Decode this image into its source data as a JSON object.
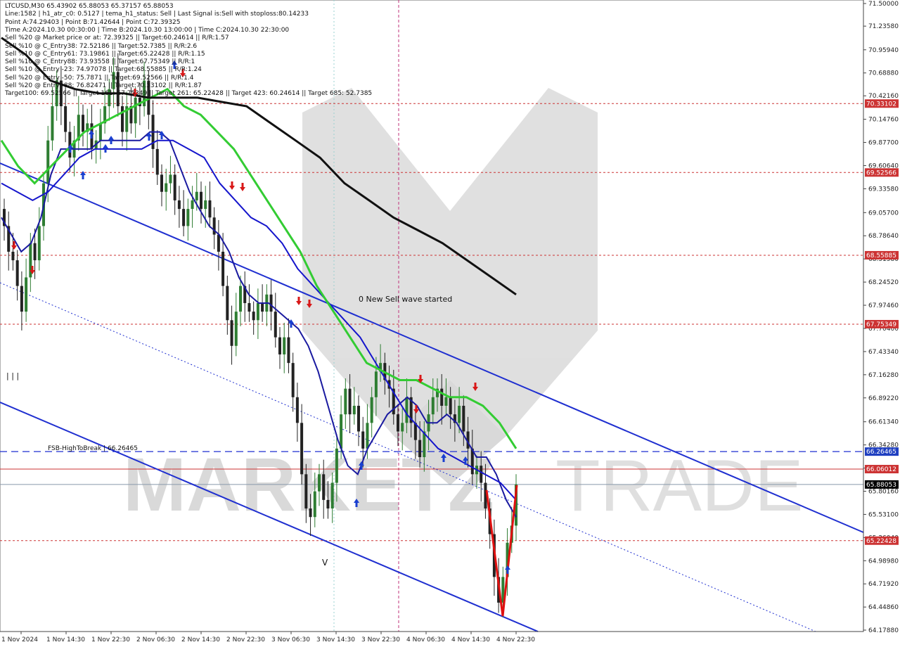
{
  "header": {
    "lines": [
      "LTCUSD,M30  65.43902 65.88053 65.37157 65.88053",
      "Line:1582  |  h1_atr_c0: 0.5127  |  tema_h1_status: Sell  |  Last Signal is:Sell with stoploss:80.14233",
      "Point A:74.29403  |  Point B:71.42644  |  Point C:72.39325",
      "Time A:2024.10.30 00:30:00  |  Time B:2024.10.30 13:00:00  |  Time C:2024.10.30 22:30:00",
      "Sell %20 @ Market price or at: 72.39325  ||  Target:60.24614  ||  R/R:1.57",
      "Sell %10 @ C_Entry38: 72.52186  ||  Target:52.7385  ||  R/R:2.6",
      "Sell %10 @ C_Entry61: 73.19861  ||  Target:65.22428  ||  R/R:1.15",
      "Sell %10 @ C_Entry88: 73.93558  ||  Target:67.75349  ||  R/R:1",
      "Sell %10 @ Entry -23: 74.97078  ||  Target:68.55885  ||  R/R:1.24",
      "Sell %20 @ Entry -50: 75.7871  ||  Target:69.52566  ||  R/R:1.4",
      "Sell %20 @ Entry -88: 76.82471  ||  Target:70.33102  ||  R/R:1.87",
      "Target100: 69.52566  ||  Target 161: 67.75349  ||  Target 261: 65.22428  ||  Target 423: 60.24614  ||  Target 685: 52.7385"
    ]
  },
  "annotations": {
    "sell_wave": "0 New Sell wave started",
    "fsb_label": "FSB-HighToBreak | 66.26465",
    "marks_left": "| | |",
    "v_mark": "V"
  },
  "watermark": {
    "text_left": "MARKETZ",
    "text_right": "TRADE"
  },
  "colors": {
    "bull_candle": "#2e7d32",
    "bear_candle": "#222222",
    "ema_fast": "#1a1aa0",
    "ema_mid": "#1515cc",
    "ema_green": "#33cc33",
    "ema_slow": "#111111",
    "channel": "#1f2fd0",
    "level_red": "#cc3333",
    "price_tag": "#000000",
    "fsb_tag": "#1f3fc0"
  },
  "chart_data": {
    "type": "candlestick",
    "symbol": "LTCUSD",
    "timeframe": "M30",
    "ohlc_last": {
      "open": 65.43902,
      "high": 65.88053,
      "low": 65.37157,
      "close": 65.88053
    },
    "ylim": [
      64.1788,
      71.5
    ],
    "y_ticks": [
      "71.50000",
      "71.23580",
      "70.95940",
      "70.68880",
      "70.42160",
      "70.14760",
      "69.87700",
      "69.60640",
      "69.33580",
      "69.05700",
      "68.78640",
      "68.51580",
      "68.24520",
      "67.97460",
      "67.70400",
      "67.43340",
      "67.16280",
      "66.89220",
      "66.61340",
      "66.34280",
      "66.07220",
      "65.80160",
      "65.53100",
      "65.26040",
      "64.98980",
      "64.71920",
      "64.44860",
      "64.17880"
    ],
    "x_ticks": [
      "1 Nov 2024",
      "1 Nov 14:30",
      "1 Nov 22:30",
      "2 Nov 06:30",
      "2 Nov 14:30",
      "2 Nov 22:30",
      "3 Nov 06:30",
      "3 Nov 14:30",
      "3 Nov 22:30",
      "4 Nov 06:30",
      "4 Nov 14:30",
      "4 Nov 22:30"
    ],
    "current_price": "65.88053",
    "levels": [
      {
        "value": 70.33102,
        "label": "70.33102",
        "kind": "target"
      },
      {
        "value": 69.52566,
        "label": "69.52566",
        "kind": "target"
      },
      {
        "value": 68.55885,
        "label": "68.55885",
        "kind": "target"
      },
      {
        "value": 67.75349,
        "label": "67.75349",
        "kind": "target"
      },
      {
        "value": 66.26465,
        "label": "66.26465",
        "kind": "fsb"
      },
      {
        "value": 66.06012,
        "label": "66.06012",
        "kind": "resistance"
      },
      {
        "value": 65.22428,
        "label": "65.22428",
        "kind": "target"
      }
    ],
    "closes": [
      68.9,
      68.6,
      68.5,
      68.2,
      67.9,
      68.3,
      68.7,
      68.5,
      68.9,
      69.4,
      69.9,
      70.3,
      70.6,
      70.3,
      70.0,
      69.7,
      69.9,
      70.2,
      70.0,
      70.1,
      69.8,
      69.9,
      70.1,
      70.3,
      70.5,
      70.7,
      70.3,
      70.0,
      70.3,
      70.1,
      70.4,
      70.3,
      70.6,
      70.2,
      69.8,
      69.5,
      69.3,
      69.4,
      69.5,
      69.2,
      69.1,
      68.9,
      69.1,
      69.2,
      69.3,
      69.1,
      69.2,
      69.0,
      68.8,
      68.6,
      68.2,
      67.8,
      67.5,
      67.9,
      68.2,
      68.0,
      67.9,
      67.8,
      68.0,
      67.9,
      68.1,
      67.9,
      67.6,
      67.4,
      67.6,
      67.3,
      66.9,
      66.6,
      66.0,
      65.6,
      65.5,
      65.8,
      66.0,
      65.7,
      65.6,
      65.9,
      66.3,
      66.7,
      67.0,
      66.7,
      66.8,
      66.5,
      66.3,
      66.6,
      66.9,
      67.2,
      67.3,
      67.1,
      67.0,
      66.7,
      66.5,
      66.6,
      66.9,
      66.6,
      66.4,
      66.2,
      66.5,
      66.7,
      66.9,
      67.0,
      66.8,
      66.9,
      66.7,
      66.6,
      66.8,
      66.5,
      66.3,
      66.0,
      66.1,
      65.9,
      65.6,
      65.3,
      64.8,
      64.5,
      64.8,
      65.2,
      65.4,
      65.88053
    ],
    "series": [
      {
        "name": "EMA fast",
        "color": "#1a1aa0",
        "values": [
          69.0,
          68.8,
          68.6,
          68.7,
          69.0,
          69.5,
          69.8,
          69.8,
          69.8,
          69.8,
          69.9,
          69.9,
          69.9,
          69.9,
          69.9,
          70.0,
          70.0,
          69.9,
          69.6,
          69.3,
          69.1,
          68.9,
          68.8,
          68.6,
          68.3,
          68.1,
          68.0,
          68.0,
          67.9,
          67.8,
          67.7,
          67.5,
          67.2,
          66.8,
          66.4,
          66.1,
          66.0,
          66.3,
          66.5,
          66.7,
          66.8,
          66.9,
          66.8,
          66.6,
          66.6,
          66.7,
          66.6,
          66.4,
          66.2,
          66.2,
          66.0,
          65.7,
          65.5
        ]
      },
      {
        "name": "EMA mid",
        "color": "#1515cc",
        "values": [
          69.4,
          69.3,
          69.2,
          69.3,
          69.5,
          69.7,
          69.8,
          69.8,
          69.8,
          69.8,
          69.9,
          69.9,
          69.8,
          69.7,
          69.4,
          69.2,
          69.0,
          68.9,
          68.7,
          68.4,
          68.2,
          68.0,
          67.8,
          67.6,
          67.3,
          67.0,
          66.7,
          66.5,
          66.3,
          66.2,
          66.1,
          66.0,
          65.9,
          65.7
        ]
      },
      {
        "name": "EMA green",
        "color": "#33cc33",
        "values": [
          69.9,
          69.6,
          69.4,
          69.6,
          69.8,
          70.0,
          70.1,
          70.2,
          70.3,
          70.4,
          70.5,
          70.3,
          70.2,
          70.0,
          69.8,
          69.5,
          69.2,
          68.9,
          68.6,
          68.2,
          67.9,
          67.6,
          67.3,
          67.2,
          67.1,
          67.1,
          67.0,
          66.9,
          66.9,
          66.8,
          66.6,
          66.3
        ]
      },
      {
        "name": "EMA slow",
        "color": "#111111",
        "values": [
          71.1,
          70.9,
          70.6,
          70.5,
          70.45,
          70.45,
          70.4,
          70.4,
          70.4,
          70.35,
          70.3,
          70.1,
          69.9,
          69.7,
          69.4,
          69.2,
          69.0,
          68.85,
          68.7,
          68.5,
          68.3,
          68.1
        ]
      }
    ]
  }
}
